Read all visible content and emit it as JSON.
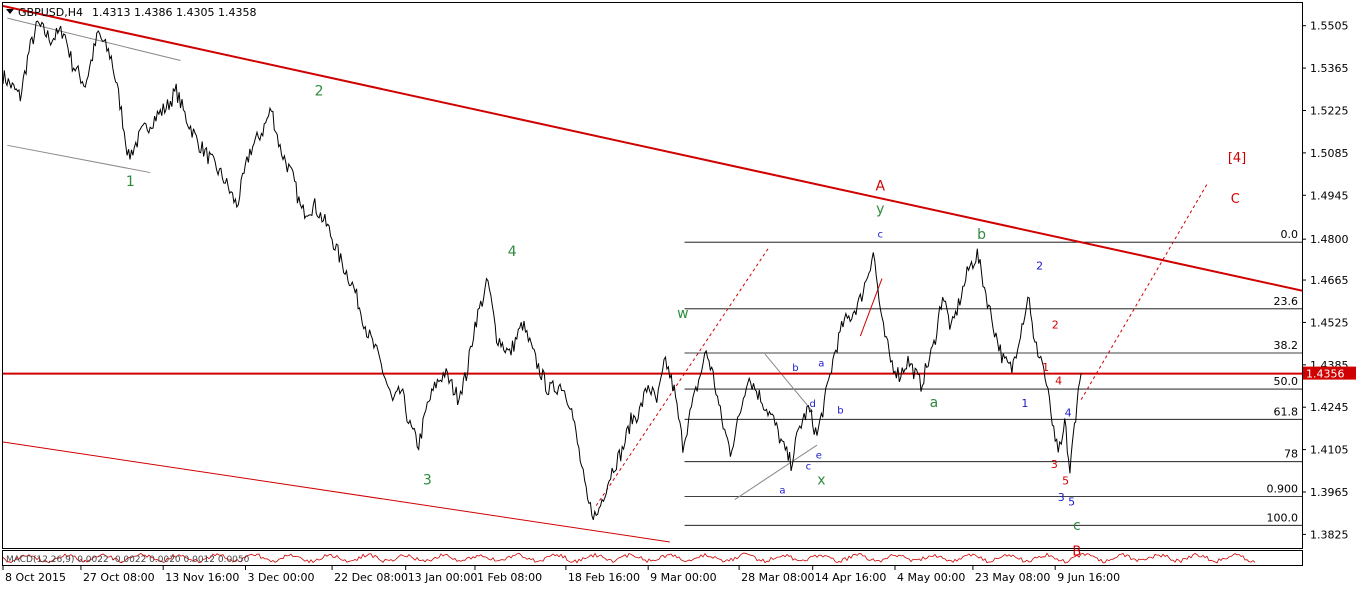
{
  "window": {
    "symbol_label": "GBPUSD,H4",
    "ohlc_label": "1.4313 1.4386 1.4305 1.4358"
  },
  "chart_data": {
    "type": "line",
    "title": "GBPUSD,H4",
    "symbol": "GBPUSD",
    "timeframe": "H4",
    "ohlc": {
      "open": 1.4313,
      "high": 1.4386,
      "low": 1.4305,
      "close": 1.4358
    },
    "current_price_label": "1.4356",
    "ylim": [
      1.378,
      1.558
    ],
    "grid": false,
    "y_ticks": [
      {
        "v": 1.5505,
        "label": "1.5505"
      },
      {
        "v": 1.5365,
        "label": "1.5365"
      },
      {
        "v": 1.5225,
        "label": "1.5225"
      },
      {
        "v": 1.5085,
        "label": "1.5085"
      },
      {
        "v": 1.4945,
        "label": "1.4945"
      },
      {
        "v": 1.48,
        "label": "1.4800"
      },
      {
        "v": 1.4665,
        "label": "1.4665"
      },
      {
        "v": 1.4525,
        "label": "1.4525"
      },
      {
        "v": 1.4385,
        "label": "1.4385"
      },
      {
        "v": 1.4245,
        "label": "1.4245"
      },
      {
        "v": 1.4105,
        "label": "1.4105"
      },
      {
        "v": 1.3965,
        "label": "1.3965"
      },
      {
        "v": 1.3825,
        "label": "1.3825"
      }
    ],
    "x_ticks": [
      {
        "i": 0,
        "label": "8 Oct 2015"
      },
      {
        "i": 90,
        "label": "27 Oct 08:00"
      },
      {
        "i": 185,
        "label": "13 Nov 16:00"
      },
      {
        "i": 280,
        "label": "3 Dec 00:00"
      },
      {
        "i": 380,
        "label": "22 Dec 08:00"
      },
      {
        "i": 465,
        "label": "13 Jan 00:00"
      },
      {
        "i": 545,
        "label": "1 Feb 08:00"
      },
      {
        "i": 650,
        "label": "18 Feb 16:00"
      },
      {
        "i": 745,
        "label": "9 Mar 00:00"
      },
      {
        "i": 850,
        "label": "28 Mar 08:00"
      },
      {
        "i": 935,
        "label": "14 Apr 16:00"
      },
      {
        "i": 1030,
        "label": "4 May 00:00"
      },
      {
        "i": 1120,
        "label": "23 May 08:00"
      },
      {
        "i": 1215,
        "label": "9 Jun 16:00"
      }
    ],
    "price_path": [
      [
        0,
        1.534
      ],
      [
        20,
        1.527
      ],
      [
        30,
        1.542
      ],
      [
        40,
        1.551
      ],
      [
        55,
        1.546
      ],
      [
        70,
        1.549
      ],
      [
        80,
        1.538
      ],
      [
        95,
        1.531
      ],
      [
        110,
        1.548
      ],
      [
        125,
        1.54
      ],
      [
        135,
        1.525
      ],
      [
        145,
        1.507
      ],
      [
        160,
        1.515
      ],
      [
        175,
        1.52
      ],
      [
        190,
        1.524
      ],
      [
        200,
        1.529
      ],
      [
        210,
        1.521
      ],
      [
        225,
        1.512
      ],
      [
        240,
        1.506
      ],
      [
        255,
        1.5
      ],
      [
        270,
        1.491
      ],
      [
        285,
        1.509
      ],
      [
        300,
        1.516
      ],
      [
        310,
        1.523
      ],
      [
        320,
        1.51
      ],
      [
        335,
        1.5
      ],
      [
        345,
        1.489
      ],
      [
        360,
        1.491
      ],
      [
        375,
        1.484
      ],
      [
        390,
        1.473
      ],
      [
        405,
        1.464
      ],
      [
        420,
        1.45
      ],
      [
        435,
        1.44
      ],
      [
        450,
        1.426
      ],
      [
        460,
        1.43
      ],
      [
        470,
        1.418
      ],
      [
        480,
        1.412
      ],
      [
        490,
        1.425
      ],
      [
        500,
        1.432
      ],
      [
        510,
        1.436
      ],
      [
        525,
        1.428
      ],
      [
        535,
        1.435
      ],
      [
        545,
        1.452
      ],
      [
        560,
        1.466
      ],
      [
        570,
        1.448
      ],
      [
        585,
        1.442
      ],
      [
        600,
        1.452
      ],
      [
        615,
        1.44
      ],
      [
        630,
        1.43
      ],
      [
        645,
        1.432
      ],
      [
        655,
        1.426
      ],
      [
        665,
        1.41
      ],
      [
        675,
        1.393
      ],
      [
        685,
        1.388
      ],
      [
        695,
        1.397
      ],
      [
        705,
        1.405
      ],
      [
        715,
        1.41
      ],
      [
        725,
        1.42
      ],
      [
        735,
        1.423
      ],
      [
        745,
        1.432
      ],
      [
        755,
        1.426
      ],
      [
        765,
        1.44
      ],
      [
        775,
        1.43
      ],
      [
        785,
        1.412
      ],
      [
        795,
        1.424
      ],
      [
        805,
        1.435
      ],
      [
        812,
        1.443
      ],
      [
        820,
        1.435
      ],
      [
        830,
        1.42
      ],
      [
        840,
        1.41
      ],
      [
        850,
        1.421
      ],
      [
        860,
        1.435
      ],
      [
        870,
        1.43
      ],
      [
        880,
        1.425
      ],
      [
        890,
        1.42
      ],
      [
        900,
        1.412
      ],
      [
        910,
        1.406
      ],
      [
        920,
        1.418
      ],
      [
        930,
        1.424
      ],
      [
        940,
        1.415
      ],
      [
        950,
        1.428
      ],
      [
        960,
        1.442
      ],
      [
        970,
        1.452
      ],
      [
        980,
        1.455
      ],
      [
        990,
        1.46
      ],
      [
        1000,
        1.47
      ],
      [
        1005,
        1.476
      ],
      [
        1015,
        1.452
      ],
      [
        1025,
        1.44
      ],
      [
        1035,
        1.435
      ],
      [
        1045,
        1.44
      ],
      [
        1060,
        1.432
      ],
      [
        1075,
        1.445
      ],
      [
        1085,
        1.462
      ],
      [
        1095,
        1.45
      ],
      [
        1105,
        1.46
      ],
      [
        1115,
        1.47
      ],
      [
        1125,
        1.475
      ],
      [
        1135,
        1.462
      ],
      [
        1145,
        1.45
      ],
      [
        1155,
        1.44
      ],
      [
        1165,
        1.437
      ],
      [
        1175,
        1.45
      ],
      [
        1185,
        1.462
      ],
      [
        1190,
        1.446
      ],
      [
        1200,
        1.44
      ],
      [
        1210,
        1.423
      ],
      [
        1215,
        1.412
      ],
      [
        1222,
        1.41
      ],
      [
        1226,
        1.42
      ],
      [
        1232,
        1.403
      ],
      [
        1236,
        1.415
      ],
      [
        1240,
        1.426
      ],
      [
        1245,
        1.4358
      ]
    ],
    "fibonacci": {
      "levels": [
        {
          "v": 1.479,
          "label": "0.0"
        },
        {
          "v": 1.457,
          "label": "23.6"
        },
        {
          "v": 1.4424,
          "label": "38.2"
        },
        {
          "v": 1.4305,
          "label": "50.0"
        },
        {
          "v": 1.4205,
          "label": "61.8"
        },
        {
          "v": 1.4065,
          "label": "78"
        },
        {
          "v": 1.395,
          "label": "0.900"
        },
        {
          "v": 1.3855,
          "label": "100.0"
        }
      ]
    },
    "horizontal_line": 1.4356,
    "trendlines": [
      {
        "name": "upper-channel",
        "color": "#d00000",
        "width": 2,
        "dashed": false,
        "p1": [
          0,
          1.557
        ],
        "p2": [
          1500,
          1.463
        ]
      },
      {
        "name": "lower-channel",
        "color": "#d00000",
        "width": 1,
        "dashed": false,
        "p1": [
          0,
          1.413
        ],
        "p2": [
          770,
          1.38
        ]
      },
      {
        "name": "dash-left",
        "color": "#d00000",
        "width": 1,
        "dashed": true,
        "p1": [
          685,
          1.392
        ],
        "p2": [
          885,
          1.4775
        ]
      },
      {
        "name": "dash-right",
        "color": "#d00000",
        "width": 1,
        "dashed": true,
        "p1": [
          1245,
          1.427
        ],
        "p2": [
          1390,
          1.498
        ]
      },
      {
        "name": "top-gray",
        "color": "#8a8a8a",
        "width": 1,
        "dashed": false,
        "p1": [
          5,
          1.553
        ],
        "p2": [
          205,
          1.539
        ]
      },
      {
        "name": "gray-left",
        "color": "#8a8a8a",
        "width": 1,
        "dashed": false,
        "p1": [
          5,
          1.511
        ],
        "p2": [
          170,
          1.502
        ]
      },
      {
        "name": "gray-low",
        "color": "#8a8a8a",
        "width": 1,
        "dashed": false,
        "p1": [
          845,
          1.394
        ],
        "p2": [
          940,
          1.412
        ]
      },
      {
        "name": "gray-diag",
        "color": "#8a8a8a",
        "width": 1,
        "dashed": false,
        "p1": [
          880,
          1.442
        ],
        "p2": [
          935,
          1.423
        ]
      },
      {
        "name": "red-thin",
        "color": "#d00000",
        "width": 1,
        "dashed": false,
        "p1": [
          990,
          1.448
        ],
        "p2": [
          1015,
          1.467
        ]
      }
    ],
    "wave_labels": [
      {
        "text": "1",
        "i": 147,
        "v": 1.4975,
        "color": "#2e8b3d",
        "size": 14
      },
      {
        "text": "2",
        "i": 365,
        "v": 1.5275,
        "color": "#2e8b3d",
        "size": 14
      },
      {
        "text": "3",
        "i": 490,
        "v": 1.399,
        "color": "#2e8b3d",
        "size": 14
      },
      {
        "text": "4",
        "i": 588,
        "v": 1.4745,
        "color": "#2e8b3d",
        "size": 14
      },
      {
        "text": "w",
        "i": 785,
        "v": 1.454,
        "color": "#2e8b3d",
        "size": 14
      },
      {
        "text": "x",
        "i": 945,
        "v": 1.399,
        "color": "#2e8b3d",
        "size": 14
      },
      {
        "text": "y",
        "i": 1013,
        "v": 1.4885,
        "color": "#2e8b3d",
        "size": 14
      },
      {
        "text": "a",
        "i": 1075,
        "v": 1.4245,
        "color": "#2e8b3d",
        "size": 14
      },
      {
        "text": "b",
        "i": 1130,
        "v": 1.48,
        "color": "#2e8b3d",
        "size": 14
      },
      {
        "text": "c",
        "i": 1240,
        "v": 1.384,
        "color": "#2e8b3d",
        "size": 14
      },
      {
        "text": "A",
        "i": 1013,
        "v": 1.496,
        "color": "#d00000",
        "size": 14
      },
      {
        "text": "[4]",
        "i": 1425,
        "v": 1.5055,
        "color": "#d00000",
        "size": 13
      },
      {
        "text": "C",
        "i": 1423,
        "v": 1.492,
        "color": "#d00000",
        "size": 13
      },
      {
        "text": "B",
        "i": 1240,
        "v": 1.3755,
        "color": "#d00000",
        "size": 13
      },
      {
        "text": "1",
        "i": 1204,
        "v": 1.4365,
        "color": "#d00000",
        "size": 11
      },
      {
        "text": "2",
        "i": 1215,
        "v": 1.4505,
        "color": "#d00000",
        "size": 11
      },
      {
        "text": "3",
        "i": 1214,
        "v": 1.4045,
        "color": "#d00000",
        "size": 11
      },
      {
        "text": "4",
        "i": 1219,
        "v": 1.432,
        "color": "#d00000",
        "size": 11
      },
      {
        "text": "5",
        "i": 1227,
        "v": 1.399,
        "color": "#d00000",
        "size": 11
      },
      {
        "text": "a",
        "i": 900,
        "v": 1.396,
        "color": "#1a1acc",
        "size": 10
      },
      {
        "text": "b",
        "i": 915,
        "v": 1.4365,
        "color": "#1a1acc",
        "size": 10
      },
      {
        "text": "c",
        "i": 930,
        "v": 1.404,
        "color": "#1a1acc",
        "size": 10
      },
      {
        "text": "d",
        "i": 935,
        "v": 1.4245,
        "color": "#1a1acc",
        "size": 10
      },
      {
        "text": "e",
        "i": 942,
        "v": 1.4075,
        "color": "#1a1acc",
        "size": 10
      },
      {
        "text": "a",
        "i": 945,
        "v": 1.438,
        "color": "#1a1acc",
        "size": 10
      },
      {
        "text": "b",
        "i": 967,
        "v": 1.4225,
        "color": "#1a1acc",
        "size": 10
      },
      {
        "text": "c",
        "i": 1013,
        "v": 1.4805,
        "color": "#1a1acc",
        "size": 10
      },
      {
        "text": "1",
        "i": 1180,
        "v": 1.4245,
        "color": "#1a1acc",
        "size": 11
      },
      {
        "text": "2",
        "i": 1197,
        "v": 1.47,
        "color": "#1a1acc",
        "size": 11
      },
      {
        "text": "3",
        "i": 1222,
        "v": 1.3935,
        "color": "#1a1acc",
        "size": 11
      },
      {
        "text": "4",
        "i": 1230,
        "v": 1.4215,
        "color": "#1a1acc",
        "size": 11
      },
      {
        "text": "5",
        "i": 1234,
        "v": 1.392,
        "color": "#1a1acc",
        "size": 11
      }
    ],
    "indicator_label": "MACD(12,26,9) 0.0022 -0.0022 0.0020 0.0012 0.0050"
  },
  "colors": {
    "price": "#000000",
    "fib": "#000000",
    "horizontal_line": "#d00000",
    "price_box_bg": "#d00000",
    "price_box_text": "#ffffff",
    "indicator": "#cc0000",
    "frame": "#000000"
  },
  "icons": {
    "symbol_menu": "chevron-down-icon"
  }
}
